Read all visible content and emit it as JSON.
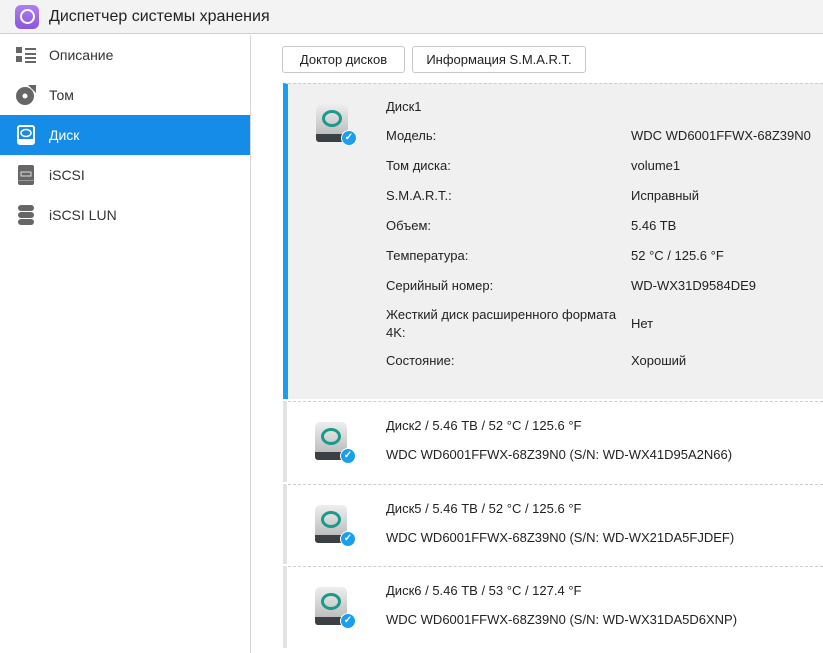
{
  "app": {
    "title": "Диспетчер системы хранения"
  },
  "sidebar": {
    "items": [
      {
        "label": "Описание"
      },
      {
        "label": "Том"
      },
      {
        "label": "Диск"
      },
      {
        "label": "iSCSI"
      },
      {
        "label": "iSCSI LUN"
      }
    ]
  },
  "toolbar": {
    "doctor": "Доктор дисков",
    "smart": "Информация S.M.A.R.T."
  },
  "selected": {
    "name": "Диск1",
    "fields": [
      {
        "label": "Модель:",
        "value": "WDC WD6001FFWX-68Z39N0"
      },
      {
        "label": "Том диска:",
        "value": "volume1"
      },
      {
        "label": "S.M.A.R.T.:",
        "value": "Исправный"
      },
      {
        "label": "Объем:",
        "value": "5.46 TB"
      },
      {
        "label": "Температура:",
        "value": "52 °C / 125.6 °F"
      },
      {
        "label": "Серийный номер:",
        "value": "WD-WX31D9584DE9"
      },
      {
        "label": "Жесткий диск расширенного формата 4K:",
        "value": "Нет"
      },
      {
        "label": "Состояние:",
        "value": "Хороший"
      }
    ]
  },
  "disks": [
    {
      "title": "Диск2 / 5.46 TB / 52 °C / 125.6 °F",
      "detail": "WDC WD6001FFWX-68Z39N0 (S/N: WD-WX41D95A2N66)"
    },
    {
      "title": "Диск5 / 5.46 TB / 52 °C / 125.6 °F",
      "detail": "WDC WD6001FFWX-68Z39N0 (S/N: WD-WX21DA5FJDEF)"
    },
    {
      "title": "Диск6 / 5.46 TB / 53 °C / 127.4 °F",
      "detail": "WDC WD6001FFWX-68Z39N0 (S/N: WD-WX31DA5D6XNP)"
    }
  ],
  "colors": {
    "accent": "#168ce9",
    "disk_ring": "#1a9a8a"
  }
}
